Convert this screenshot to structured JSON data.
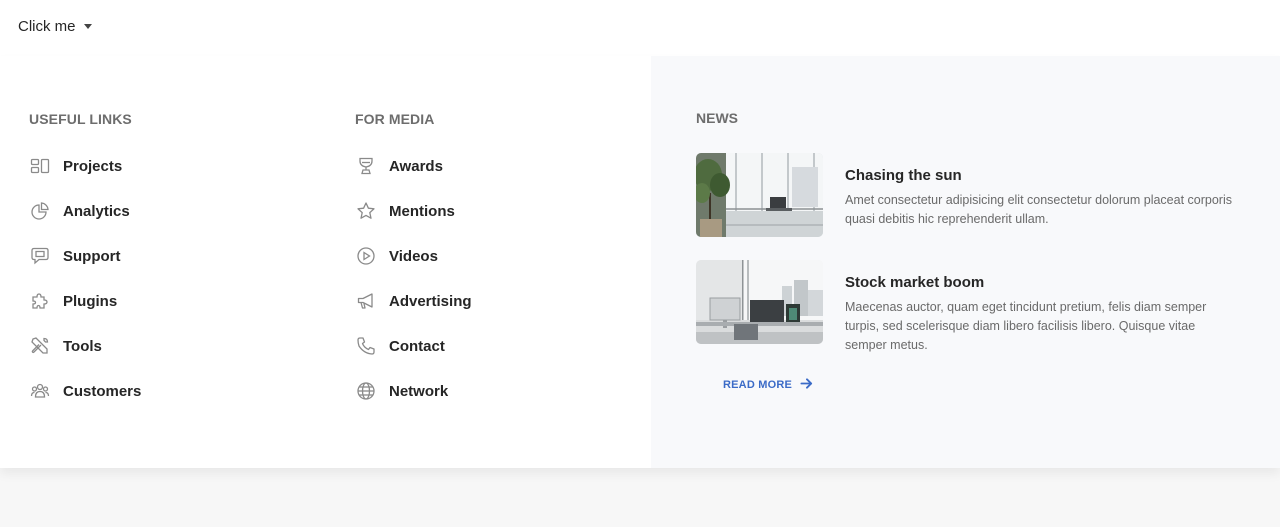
{
  "trigger": {
    "label": "Click me",
    "icon": "caret-down-icon"
  },
  "useful_links": {
    "title": "USEFUL LINKS",
    "items": [
      {
        "label": "Projects",
        "icon": "projects-icon"
      },
      {
        "label": "Analytics",
        "icon": "pie-chart-icon"
      },
      {
        "label": "Support",
        "icon": "chat-icon"
      },
      {
        "label": "Plugins",
        "icon": "puzzle-icon"
      },
      {
        "label": "Tools",
        "icon": "tools-icon"
      },
      {
        "label": "Customers",
        "icon": "users-icon"
      }
    ]
  },
  "for_media": {
    "title": "FOR MEDIA",
    "items": [
      {
        "label": "Awards",
        "icon": "trophy-icon"
      },
      {
        "label": "Mentions",
        "icon": "star-icon"
      },
      {
        "label": "Videos",
        "icon": "play-circle-icon"
      },
      {
        "label": "Advertising",
        "icon": "megaphone-icon"
      },
      {
        "label": "Contact",
        "icon": "phone-icon"
      },
      {
        "label": "Network",
        "icon": "globe-icon"
      }
    ]
  },
  "news": {
    "title": "NEWS",
    "items": [
      {
        "title": "Chasing the sun",
        "text": "Amet consectetur adipisicing elit consectetur dolorum placeat corporis quasi debitis hic reprehenderit ullam."
      },
      {
        "title": "Stock market boom",
        "text": "Maecenas auctor, quam eget tincidunt pretium, felis diam semper turpis, sed scelerisque diam libero facilisis libero. Quisque vitae semper metus."
      }
    ],
    "read_more": "READ MORE",
    "read_more_icon": "arrow-right-icon"
  },
  "colors": {
    "accent": "#3b6bc7",
    "panel_bg": "#ffffff",
    "news_bg": "#f8f9fb",
    "heading_gray": "#6d6d6d"
  }
}
